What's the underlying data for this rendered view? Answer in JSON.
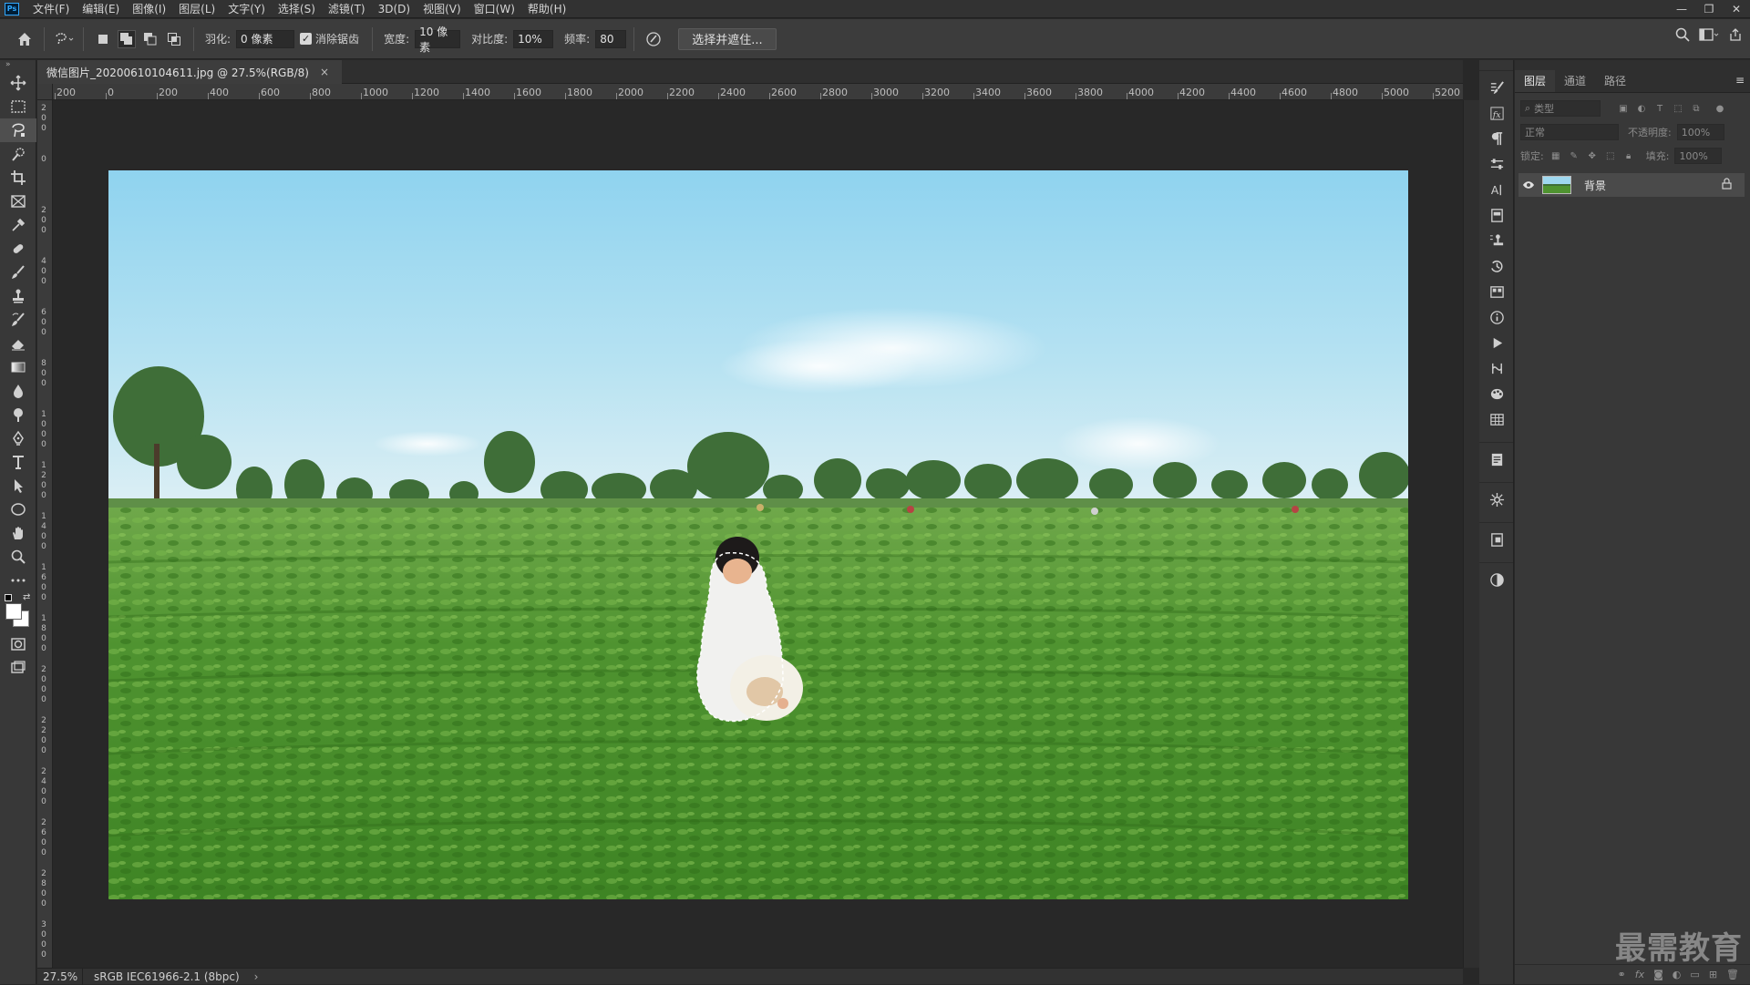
{
  "app": {
    "logo": "Ps"
  },
  "menu": [
    {
      "label": "文件(F)"
    },
    {
      "label": "编辑(E)"
    },
    {
      "label": "图像(I)"
    },
    {
      "label": "图层(L)"
    },
    {
      "label": "文字(Y)"
    },
    {
      "label": "选择(S)"
    },
    {
      "label": "滤镜(T)"
    },
    {
      "label": "3D(D)"
    },
    {
      "label": "视图(V)"
    },
    {
      "label": "窗口(W)"
    },
    {
      "label": "帮助(H)"
    }
  ],
  "window_controls": {
    "minimize": "—",
    "restore": "❐",
    "close": "✕"
  },
  "options": {
    "feather_label": "羽化:",
    "feather_value": "0 像素",
    "antialias_label": "消除锯齿",
    "antialias_checked": true,
    "width_label": "宽度:",
    "width_value": "10 像素",
    "contrast_label": "对比度:",
    "contrast_value": "10%",
    "frequency_label": "频率:",
    "frequency_value": "80",
    "select_mask_label": "选择并遮住..."
  },
  "document": {
    "tab_title": "微信图片_20200610104611.jpg @ 27.5%(RGB/8)",
    "close": "×"
  },
  "ruler_top": [
    "200",
    "0",
    "200",
    "400",
    "600",
    "800",
    "1000",
    "1200",
    "1400",
    "1600",
    "1800",
    "2000",
    "2200",
    "2400",
    "2600",
    "2800",
    "3000",
    "3200",
    "3400",
    "3600",
    "3800",
    "4000",
    "4200",
    "4400",
    "4600",
    "4800",
    "5000",
    "5200"
  ],
  "ruler_left": [
    "200",
    "0",
    "200",
    "400",
    "600",
    "800",
    "1000",
    "1200",
    "1400",
    "1600",
    "1800",
    "2000",
    "2200",
    "2400",
    "2600",
    "2800",
    "3000"
  ],
  "status": {
    "zoom": "27.5%",
    "profile": "sRGB IEC61966-2.1 (8bpc)",
    "arrow": "›"
  },
  "panel": {
    "tabs": [
      {
        "label": "图层",
        "active": true
      },
      {
        "label": "通道",
        "active": false
      },
      {
        "label": "路径",
        "active": false
      }
    ],
    "filter_placeholder": "类型",
    "blend_mode": "正常",
    "opacity_label": "不透明度:",
    "opacity_value": "100%",
    "lock_label": "锁定:",
    "fill_label": "填充:",
    "fill_value": "100%",
    "layers": [
      {
        "name": "背景",
        "visible": true,
        "locked": true
      }
    ]
  },
  "watermark": "最需教育",
  "colors": {
    "sky_top": "#8fd3ef",
    "sky_bottom": "#dff0f4",
    "field": "#4a8e2a",
    "ui_bg": "#282828",
    "panel_bg": "#383838"
  }
}
